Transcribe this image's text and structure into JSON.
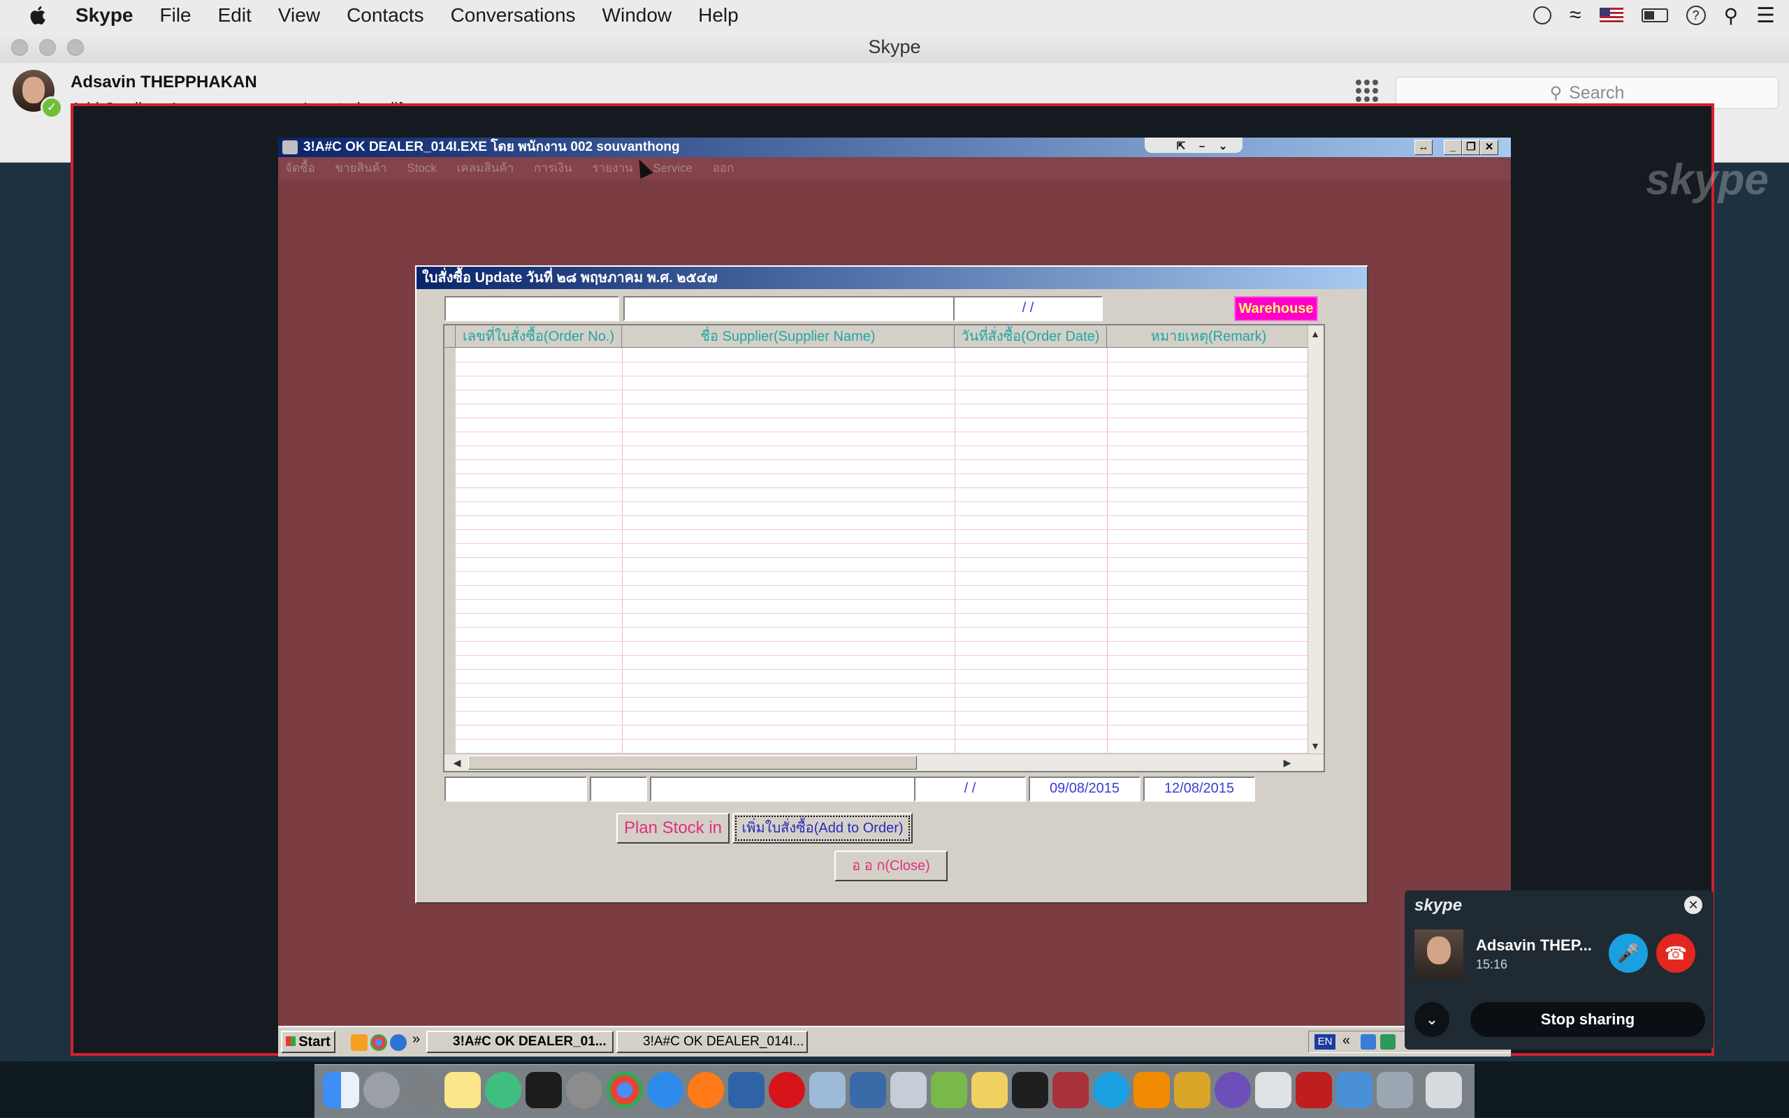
{
  "menubar": {
    "app_name": "Skype",
    "items": [
      "File",
      "Edit",
      "View",
      "Contacts",
      "Conversations",
      "Window",
      "Help"
    ]
  },
  "window": {
    "title": "Skype"
  },
  "profile": {
    "name": "Adsavin THEPPHAKAN",
    "add_credit": "Add Credit",
    "mood": "I am programmer, I control my life"
  },
  "search": {
    "placeholder": "Search"
  },
  "shared_screen": {
    "watermark": "skype",
    "remote_title": "3!A#C OK DEALER_014I.EXE โดย พนักงาน 002 souvanthong",
    "remote_menu": [
      "จัดซื้อ",
      "ขายสินค้า",
      "Stock",
      "เคลมสินค้า",
      "การเงิน",
      "รายงาน",
      "Service",
      "ออก"
    ],
    "dialog": {
      "title": "ใบสั่งซื้อ Update วันที่ ๒๘ พฤษภาคม พ.ศ. ๒๕๔๗",
      "date_filter": "/ /",
      "warehouse_label": "Warehouse",
      "columns": [
        "เลขที่ใบสั่งซื้อ(Order No.)",
        "ชื่อ Supplier(Supplier Name)",
        "วันที่สั่งซื้อ(Order Date)",
        "หมายเหตุ(Remark)"
      ],
      "footer_date_blank": "/ /",
      "footer_date_1": "09/08/2015",
      "footer_date_2": "12/08/2015",
      "plan_stock_label": "Plan Stock in",
      "add_order_label": "เพิ่มใบสั่งซื้อ(Add to Order)",
      "close_label": "อ อ ก(Close)"
    },
    "taskbar": {
      "start_label": "Start",
      "tasks": [
        "3!A#C OK DEALER_01...",
        "3!A#C OK DEALER_014I..."
      ],
      "lang": "EN"
    }
  },
  "call_widget": {
    "logo": "skype",
    "caller_name": "Adsavin THEP...",
    "duration": "15:16",
    "stop_sharing_label": "Stop sharing"
  },
  "colors": {
    "share_border": "#d22030",
    "remote_desktop": "#7c3d42",
    "warehouse_bg": "#ff00cc",
    "column_header_text": "#1fa7a0",
    "hangup": "#e3261f",
    "mic": "#1aa0e0"
  }
}
